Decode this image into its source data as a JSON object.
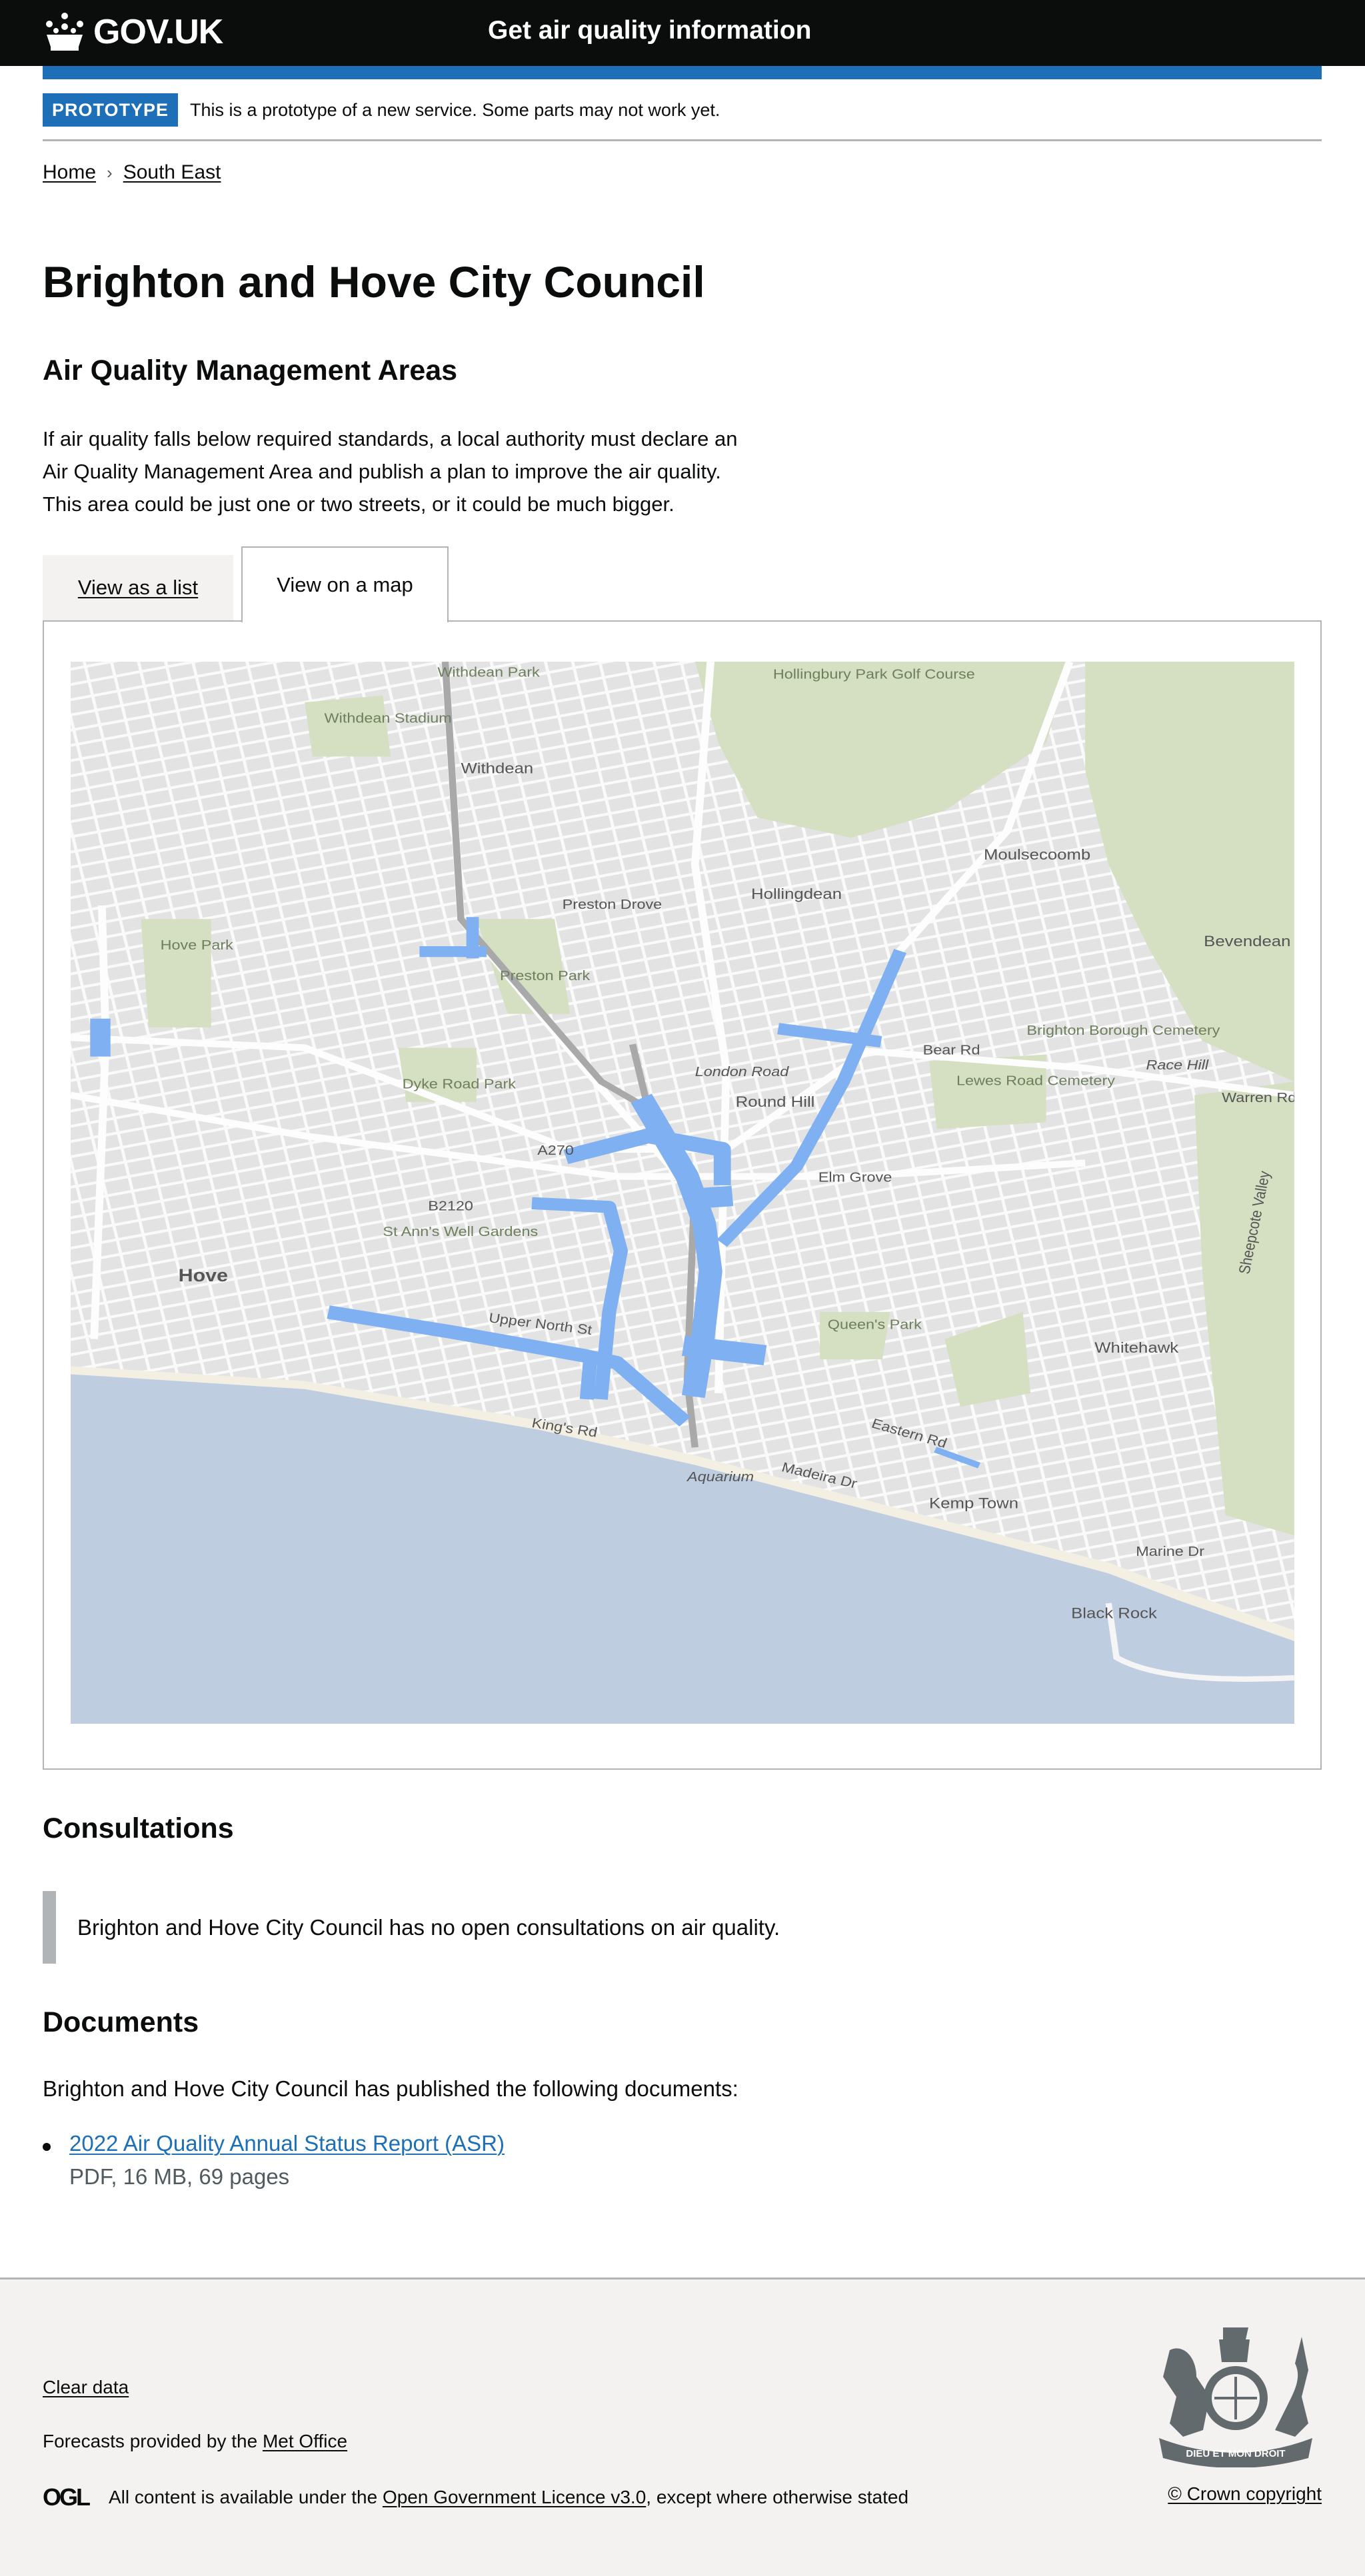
{
  "header": {
    "logo_text": "GOV.UK",
    "service_name": "Get air quality information"
  },
  "phase_banner": {
    "tag": "PROTOTYPE",
    "text": "This is a prototype of a new service. Some parts may not work yet."
  },
  "breadcrumbs": [
    {
      "label": "Home"
    },
    {
      "label": "South East"
    }
  ],
  "page_title": "Brighton and Hove City Council",
  "aqma": {
    "heading": "Air Quality Management Areas",
    "lines": [
      "If air quality falls below required standards, a local authority must declare an",
      "Air Quality Management Area and publish a plan to improve the air quality.",
      "This area could be just one or two streets, or it could be much bigger."
    ],
    "tabs": [
      {
        "label": "View as a list",
        "selected": false
      },
      {
        "label": "View on a map",
        "selected": true
      }
    ]
  },
  "map": {
    "colors": {
      "land": "#e6e6e6",
      "sea": "#bfcde0",
      "green": "#d5dfc2",
      "aqma": "#7fb0f2"
    },
    "labels": [
      "Withdean Park",
      "Withdean Stadium",
      "Hollingbury Park Golf Course",
      "Withdean",
      "Preston Park",
      "Hollingdean",
      "Moulsecoomb",
      "Bevendean",
      "Hove Park",
      "Dyke Road Park",
      "Round Hill",
      "Lewes Road Cemetery",
      "Brighton Borough Cemetery",
      "Race Hill",
      "Hove",
      "St Ann's Well Gardens",
      "Queen's Park",
      "Whitehawk",
      "Kemp Town",
      "Black Rock",
      "Aquarium",
      "Sheepcote Valley",
      "London Road",
      "Preston Drove",
      "Upper North St",
      "King's Rd",
      "Eastern Rd",
      "Elm Grove",
      "Bear Rd",
      "Marine Dr",
      "Madeira Dr",
      "Warren Rd",
      "A270",
      "B2120"
    ]
  },
  "consultations": {
    "heading": "Consultations",
    "text": "Brighton and Hove City Council has no open consultations on air quality."
  },
  "documents": {
    "heading": "Documents",
    "intro": "Brighton and Hove City Council has published the following documents:",
    "items": [
      {
        "title": "2022 Air Quality Annual Status Report (ASR)",
        "meta": "PDF, 16 MB, 69 pages"
      }
    ]
  },
  "footer": {
    "clear_data": "Clear data",
    "forecasts_prefix": "Forecasts provided by the",
    "met_office": "Met Office",
    "ogl_logo": "OGL",
    "licence_prefix": "All content is available under the",
    "licence_link": "Open Government Licence v3.0",
    "licence_suffix": ", except where otherwise stated",
    "copyright": "© Crown copyright",
    "crest_motto": "DIEU ET MON DROIT"
  }
}
